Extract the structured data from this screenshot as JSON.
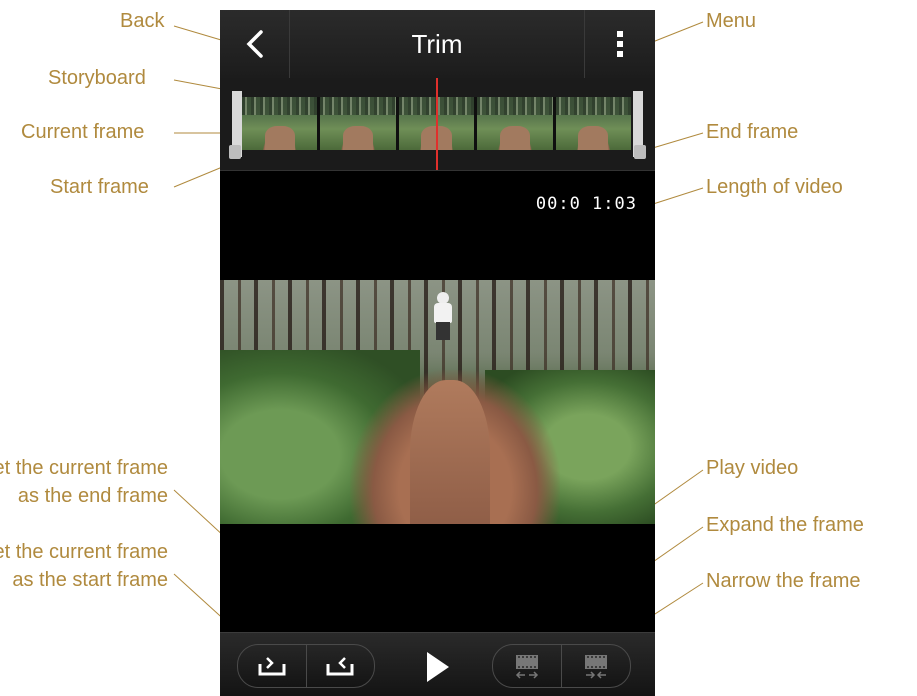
{
  "app": {
    "title": "Trim"
  },
  "status": {
    "length": "00:0 1:03"
  },
  "callouts": {
    "back": "Back",
    "menu": "Menu",
    "storyboard": "Storyboard",
    "current_frame": "Current frame",
    "end_frame": "End frame",
    "start_frame": "Start frame",
    "length_of_video": "Length of video",
    "set_end_line1": "Set the current frame",
    "set_end_line2": "as the end frame",
    "set_start_line1": "Set the current frame",
    "set_start_line2": "as the start frame",
    "play_video": "Play video",
    "expand_frame": "Expand the frame",
    "narrow_frame": "Narrow the frame"
  },
  "icons": {
    "back": "chevron-left-icon",
    "menu": "more-vertical-icon",
    "set_start": "set-start-frame-icon",
    "set_end": "set-end-frame-icon",
    "play": "play-icon",
    "expand": "expand-frame-icon",
    "narrow": "narrow-frame-icon"
  },
  "colors": {
    "callout": "#b08a3e",
    "playhead": "#e0302c",
    "background": "#000000"
  }
}
